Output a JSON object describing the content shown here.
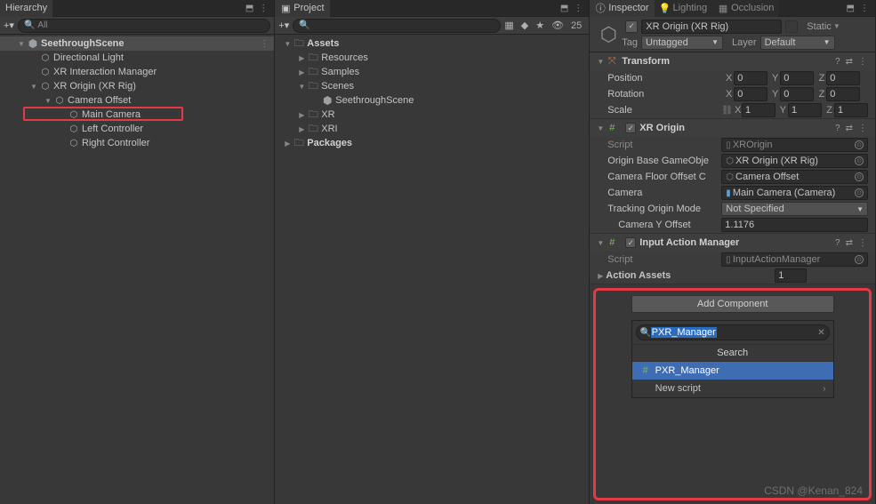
{
  "hierarchy": {
    "title": "Hierarchy",
    "search_placeholder": "All",
    "scene": "SeethroughScene",
    "items": {
      "dir_light": "Directional Light",
      "xr_interaction": "XR Interaction Manager",
      "xr_origin": "XR Origin (XR Rig)",
      "camera_offset": "Camera Offset",
      "main_camera": "Main Camera",
      "left_ctrl": "Left Controller",
      "right_ctrl": "Right Controller"
    }
  },
  "project": {
    "title": "Project",
    "count": "25",
    "assets": "Assets",
    "resources": "Resources",
    "samples": "Samples",
    "scenes": "Scenes",
    "scene_item": "SeethroughScene",
    "xr": "XR",
    "xri": "XRI",
    "packages": "Packages"
  },
  "inspector": {
    "tabs": {
      "inspector": "Inspector",
      "lighting": "Lighting",
      "occlusion": "Occlusion"
    },
    "go_name": "XR Origin (XR Rig)",
    "static": "Static",
    "tag_label": "Tag",
    "tag_value": "Untagged",
    "layer_label": "Layer",
    "layer_value": "Default",
    "transform": {
      "title": "Transform",
      "position": "Position",
      "rotation": "Rotation",
      "scale": "Scale",
      "px": "0",
      "py": "0",
      "pz": "0",
      "rx": "0",
      "ry": "0",
      "rz": "0",
      "sx": "1",
      "sy": "1",
      "sz": "1"
    },
    "xr_origin_comp": {
      "title": "XR Origin",
      "script_label": "Script",
      "script_value": "XROrigin",
      "origin_base_label": "Origin Base GameObje",
      "origin_base_value": "XR Origin (XR Rig)",
      "floor_offset_label": "Camera Floor Offset C",
      "floor_offset_value": "Camera Offset",
      "camera_label": "Camera",
      "camera_value": "Main Camera (Camera)",
      "tracking_label": "Tracking Origin Mode",
      "tracking_value": "Not Specified",
      "y_offset_label": "Camera Y Offset",
      "y_offset_value": "1.1176"
    },
    "input_action_comp": {
      "title": "Input Action Manager",
      "script_label": "Script",
      "script_value": "InputActionManager",
      "action_assets_label": "Action Assets",
      "action_assets_value": "1"
    },
    "add_component": "Add Component",
    "search_value": "PXR_Manager",
    "search_title": "Search",
    "result_item": "PXR_Manager",
    "new_script": "New script"
  },
  "watermark": "CSDN @Kenan_824"
}
